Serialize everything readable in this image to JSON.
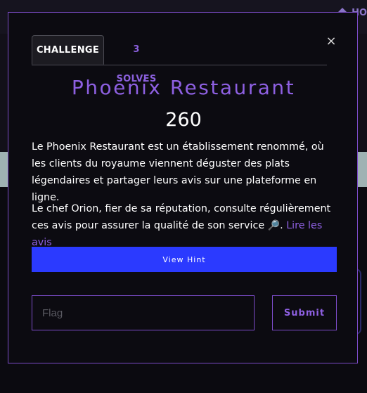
{
  "background": {
    "nav_link": "HO"
  },
  "modal": {
    "close_symbol": "×",
    "tabs": [
      {
        "label": "CHALLENGE",
        "active": true
      },
      {
        "label": "3 SOLVES",
        "active": false
      }
    ],
    "title": "Phoenix Restaurant",
    "points": "260",
    "description_1": "Le Phoenix Restaurant est un établissement renommé, où les clients du royaume viennent déguster des plats légendaires et partager leurs avis sur une plateforme en ligne.",
    "description_2_text": "Le chef Orion, fier de sa réputation, consulte régulièrement ces avis pour assurer la qualité de son service ",
    "description_2_emoji": "🔎",
    "description_2_sep": ". ",
    "description_2_link": "Lire les avis",
    "hint_button": "View Hint",
    "flag_placeholder": "Flag",
    "flag_value": "",
    "submit_button": "Submit"
  },
  "colors": {
    "accent_purple": "#8e60e2",
    "border_purple": "#7c4cc9",
    "hint_blue": "#2b3aff",
    "background": "#0b0a10"
  }
}
